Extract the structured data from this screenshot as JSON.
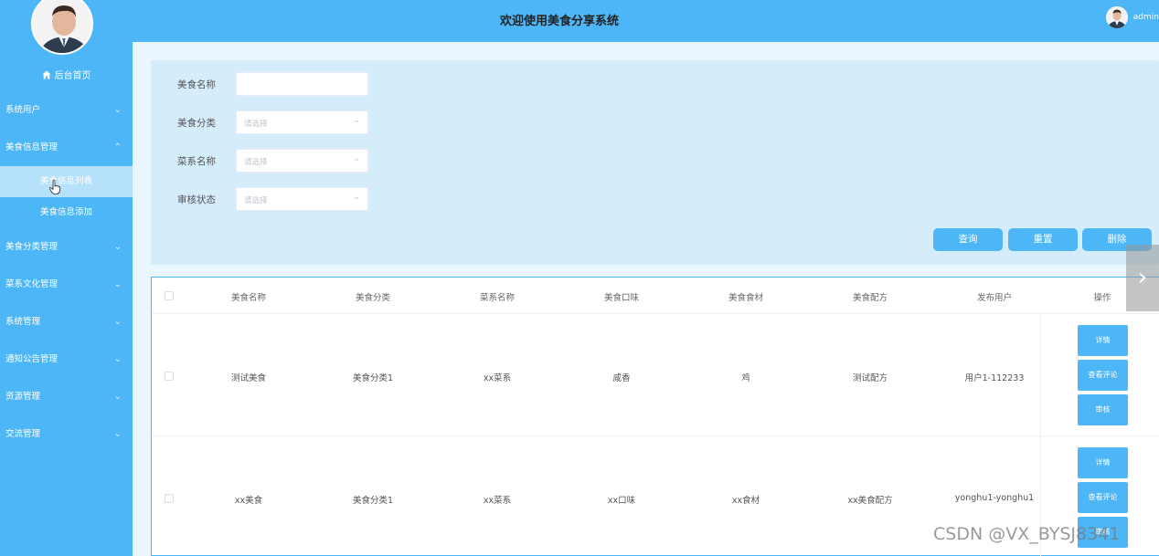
{
  "sidebar": {
    "home_label": "后台首页",
    "items": [
      {
        "label": "系统用户",
        "chevron": "⌄"
      },
      {
        "label": "美食信息管理",
        "chevron": "⌃"
      },
      {
        "label": "美食分类管理",
        "chevron": "⌄"
      },
      {
        "label": "菜系文化管理",
        "chevron": "⌄"
      },
      {
        "label": "系统管理",
        "chevron": "⌄"
      },
      {
        "label": "通知公告管理",
        "chevron": "⌄"
      },
      {
        "label": "资源管理",
        "chevron": "⌄"
      },
      {
        "label": "交流管理",
        "chevron": "⌄"
      }
    ],
    "sub_items": [
      {
        "label": "美食信息列表",
        "active": true
      },
      {
        "label": "美食信息添加",
        "active": false
      }
    ]
  },
  "header": {
    "title": "欢迎使用美食分享系统",
    "user": "admin"
  },
  "search": {
    "fields": [
      {
        "label": "美食名称",
        "value": "",
        "placeholder": ""
      },
      {
        "label": "美食分类",
        "placeholder": "请选择"
      },
      {
        "label": "菜系名称",
        "placeholder": "请选择"
      },
      {
        "label": "审核状态",
        "placeholder": "请选择"
      }
    ],
    "buttons": {
      "query": "查询",
      "reset": "重置",
      "delete": "删除"
    }
  },
  "table": {
    "columns": [
      "美食名称",
      "美食分类",
      "菜系名称",
      "美食口味",
      "美食食材",
      "美食配方",
      "发布用户",
      "操作"
    ],
    "rows": [
      {
        "cells": [
          "测试美食",
          "美食分类1",
          "xx菜系",
          "咸香",
          "鸡",
          "测试配方",
          "用户1-112233"
        ],
        "actions": [
          "详情",
          "查看评论",
          "审核"
        ]
      },
      {
        "cells": [
          "xx美食",
          "美食分类1",
          "xx菜系",
          "xx口味",
          "xx食材",
          "xx美食配方",
          "yonghu1-yonghu1"
        ],
        "actions": [
          "详情",
          "查看评论",
          "审核"
        ]
      }
    ]
  },
  "watermark": "CSDN @VX_BYSJ8341",
  "colors": {
    "primary": "#4db6f6",
    "panel": "#d5ecfb",
    "active_sub": "#b6e1fb"
  }
}
